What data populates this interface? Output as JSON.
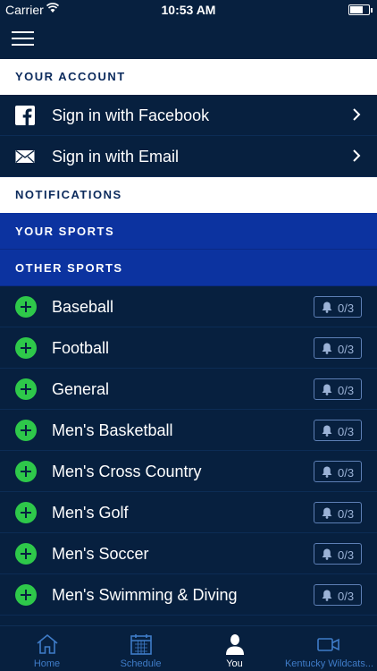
{
  "status_bar": {
    "carrier": "Carrier",
    "time": "10:53 AM"
  },
  "account": {
    "header": "YOUR ACCOUNT",
    "facebook_label": "Sign in with Facebook",
    "email_label": "Sign in with Email"
  },
  "notifications": {
    "header": "NOTIFICATIONS",
    "your_sports_header": "YOUR SPORTS",
    "other_sports_header": "OTHER SPORTS"
  },
  "sports": [
    {
      "name": "Baseball",
      "count": "0/3"
    },
    {
      "name": "Football",
      "count": "0/3"
    },
    {
      "name": "General",
      "count": "0/3"
    },
    {
      "name": "Men's Basketball",
      "count": "0/3"
    },
    {
      "name": "Men's Cross Country",
      "count": "0/3"
    },
    {
      "name": "Men's Golf",
      "count": "0/3"
    },
    {
      "name": "Men's Soccer",
      "count": "0/3"
    },
    {
      "name": "Men's Swimming & Diving",
      "count": "0/3"
    }
  ],
  "tabs": [
    {
      "label": "Home",
      "icon": "home-icon",
      "active": false
    },
    {
      "label": "Schedule",
      "icon": "calendar-icon",
      "active": false
    },
    {
      "label": "You",
      "icon": "person-icon",
      "active": true
    },
    {
      "label": "Kentucky Wildcats...",
      "icon": "video-icon",
      "active": false
    }
  ],
  "colors": {
    "background": "#07203f",
    "section_blue": "#0c33a0",
    "add_green": "#2ec84a",
    "tab_inactive": "#3f7cc8"
  }
}
